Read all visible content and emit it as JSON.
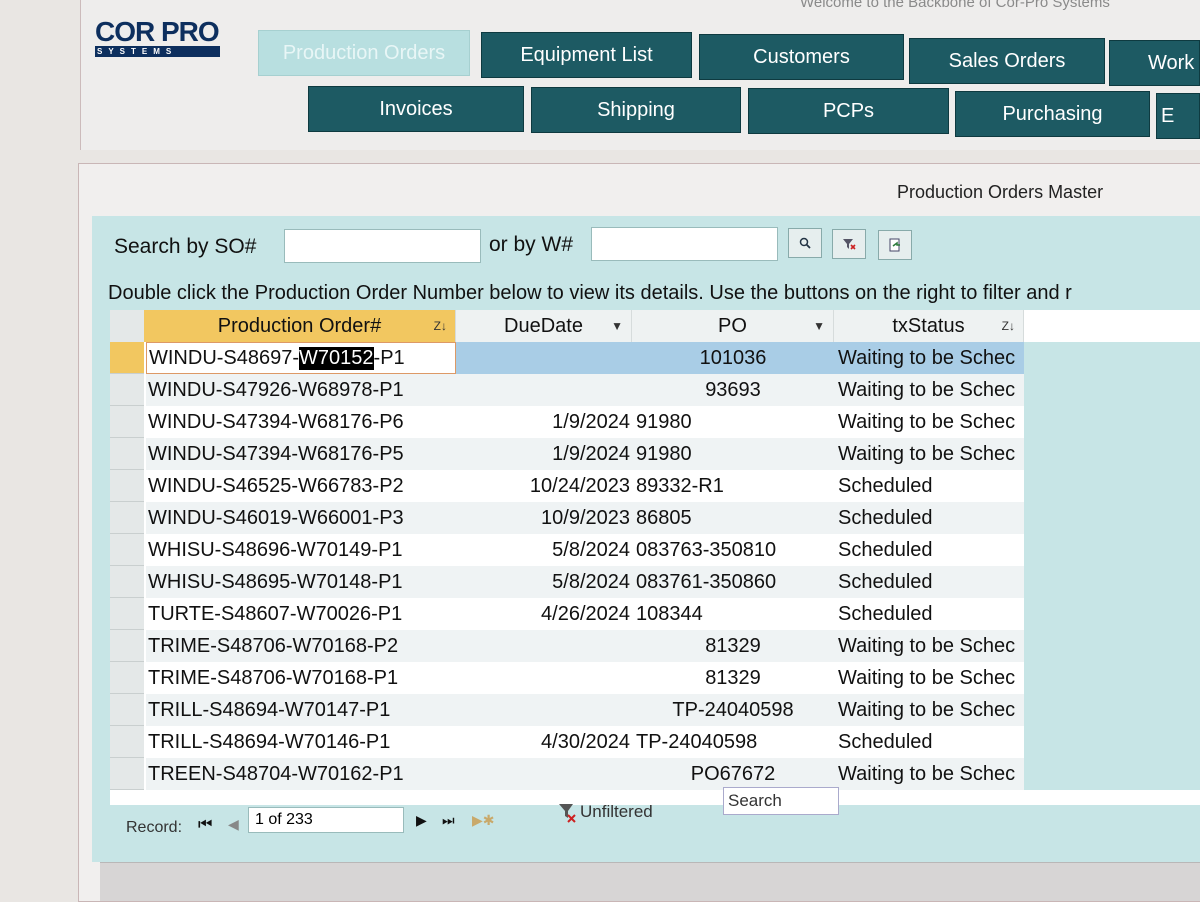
{
  "header": {
    "welcome": "Welcome to the Backbone of Cor-Pro Systems",
    "logo_text": "COR PRO",
    "logo_sub": "SYSTEMS"
  },
  "nav": {
    "row1": [
      "Production Orders",
      "Equipment List",
      "Customers",
      "Sales Orders",
      "Work"
    ],
    "row2": [
      "Invoices",
      "Shipping",
      "PCPs",
      "Purchasing",
      "E"
    ]
  },
  "page": {
    "title": "Production Orders Master",
    "search_so_label": "Search by SO#",
    "search_w_label": "or by W#",
    "search_so_value": "",
    "search_w_value": "",
    "hint": "Double click the Production Order Number below to view its details. Use the buttons on the right to filter and r"
  },
  "icons": {
    "search": "search-icon",
    "clear_filter": "clear-filter-icon",
    "export": "export-icon"
  },
  "table": {
    "columns": [
      "Production Order#",
      "DueDate",
      "PO",
      "txStatus"
    ],
    "rows": [
      {
        "order": "WINDU-S48697-W70152-P1",
        "due": "",
        "po": "101036",
        "status": "Waiting to be Schec"
      },
      {
        "order": "WINDU-S47926-W68978-P1",
        "due": "",
        "po": "93693",
        "status": "Waiting to be Schec"
      },
      {
        "order": "WINDU-S47394-W68176-P6",
        "due": "1/9/2024",
        "po": "91980",
        "status": "Waiting to be Schec"
      },
      {
        "order": "WINDU-S47394-W68176-P5",
        "due": "1/9/2024",
        "po": "91980",
        "status": "Waiting to be Schec"
      },
      {
        "order": "WINDU-S46525-W66783-P2",
        "due": "10/24/2023",
        "po": "89332-R1",
        "status": "Scheduled"
      },
      {
        "order": "WINDU-S46019-W66001-P3",
        "due": "10/9/2023",
        "po": "86805",
        "status": "Scheduled"
      },
      {
        "order": "WHISU-S48696-W70149-P1",
        "due": "5/8/2024",
        "po": "083763-350810",
        "status": "Scheduled"
      },
      {
        "order": "WHISU-S48695-W70148-P1",
        "due": "5/8/2024",
        "po": "083761-350860",
        "status": "Scheduled"
      },
      {
        "order": "TURTE-S48607-W70026-P1",
        "due": "4/26/2024",
        "po": "108344",
        "status": "Scheduled"
      },
      {
        "order": "TRIME-S48706-W70168-P2",
        "due": "",
        "po": "81329",
        "status": "Waiting to be Schec"
      },
      {
        "order": "TRIME-S48706-W70168-P1",
        "due": "",
        "po": "81329",
        "status": "Waiting to be Schec"
      },
      {
        "order": "TRILL-S48694-W70147-P1",
        "due": "",
        "po": "TP-24040598",
        "status": "Waiting to be Schec"
      },
      {
        "order": "TRILL-S48694-W70146-P1",
        "due": "4/30/2024",
        "po": "TP-24040598",
        "status": "Scheduled"
      },
      {
        "order": "TREEN-S48704-W70162-P1",
        "due": "",
        "po": "PO67672",
        "status": "Waiting to be Schec"
      }
    ],
    "selected_prefix": "WINDU-S48697-",
    "selected_highlight": "W70152",
    "selected_suffix": "-P1"
  },
  "record_nav": {
    "label": "Record:",
    "position": "1 of 233",
    "filter_label": "Unfiltered",
    "search_label": "Search"
  },
  "colors": {
    "nav": "#1d5a63",
    "form_bg": "#c7e5e6",
    "selected_row": "#a9cde6",
    "header_selected": "#f2c760"
  }
}
